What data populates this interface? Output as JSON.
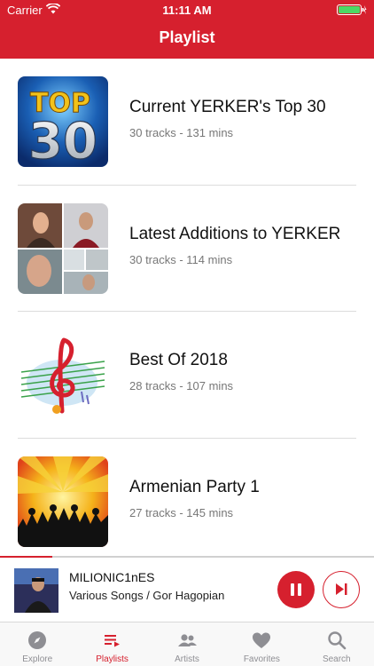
{
  "status": {
    "carrier": "Carrier",
    "time": "11:11 AM"
  },
  "nav": {
    "title": "Playlist"
  },
  "playlists": [
    {
      "title": "Current YERKER's Top 30",
      "meta": "30 tracks - 131 mins",
      "art_text_1": "TOP",
      "art_text_2": "30"
    },
    {
      "title": "Latest Additions to YERKER",
      "meta": "30 tracks - 114 mins"
    },
    {
      "title": "Best Of 2018",
      "meta": "28 tracks - 107 mins"
    },
    {
      "title": "Armenian Party 1",
      "meta": "27 tracks - 145 mins"
    }
  ],
  "now_playing": {
    "title": "MILIONIC1nES",
    "subtitle": "Various Songs / Gor Hagopian",
    "progress": 0.14
  },
  "tabs": [
    {
      "label": "Explore",
      "icon": "compass-icon",
      "active": false
    },
    {
      "label": "Playlists",
      "icon": "playlist-icon",
      "active": true
    },
    {
      "label": "Artists",
      "icon": "people-icon",
      "active": false
    },
    {
      "label": "Favorites",
      "icon": "heart-icon",
      "active": false
    },
    {
      "label": "Search",
      "icon": "search-icon",
      "active": false
    }
  ],
  "colors": {
    "accent": "#d6202e",
    "tab_inactive": "#8e8e93",
    "battery": "#4cd964"
  }
}
